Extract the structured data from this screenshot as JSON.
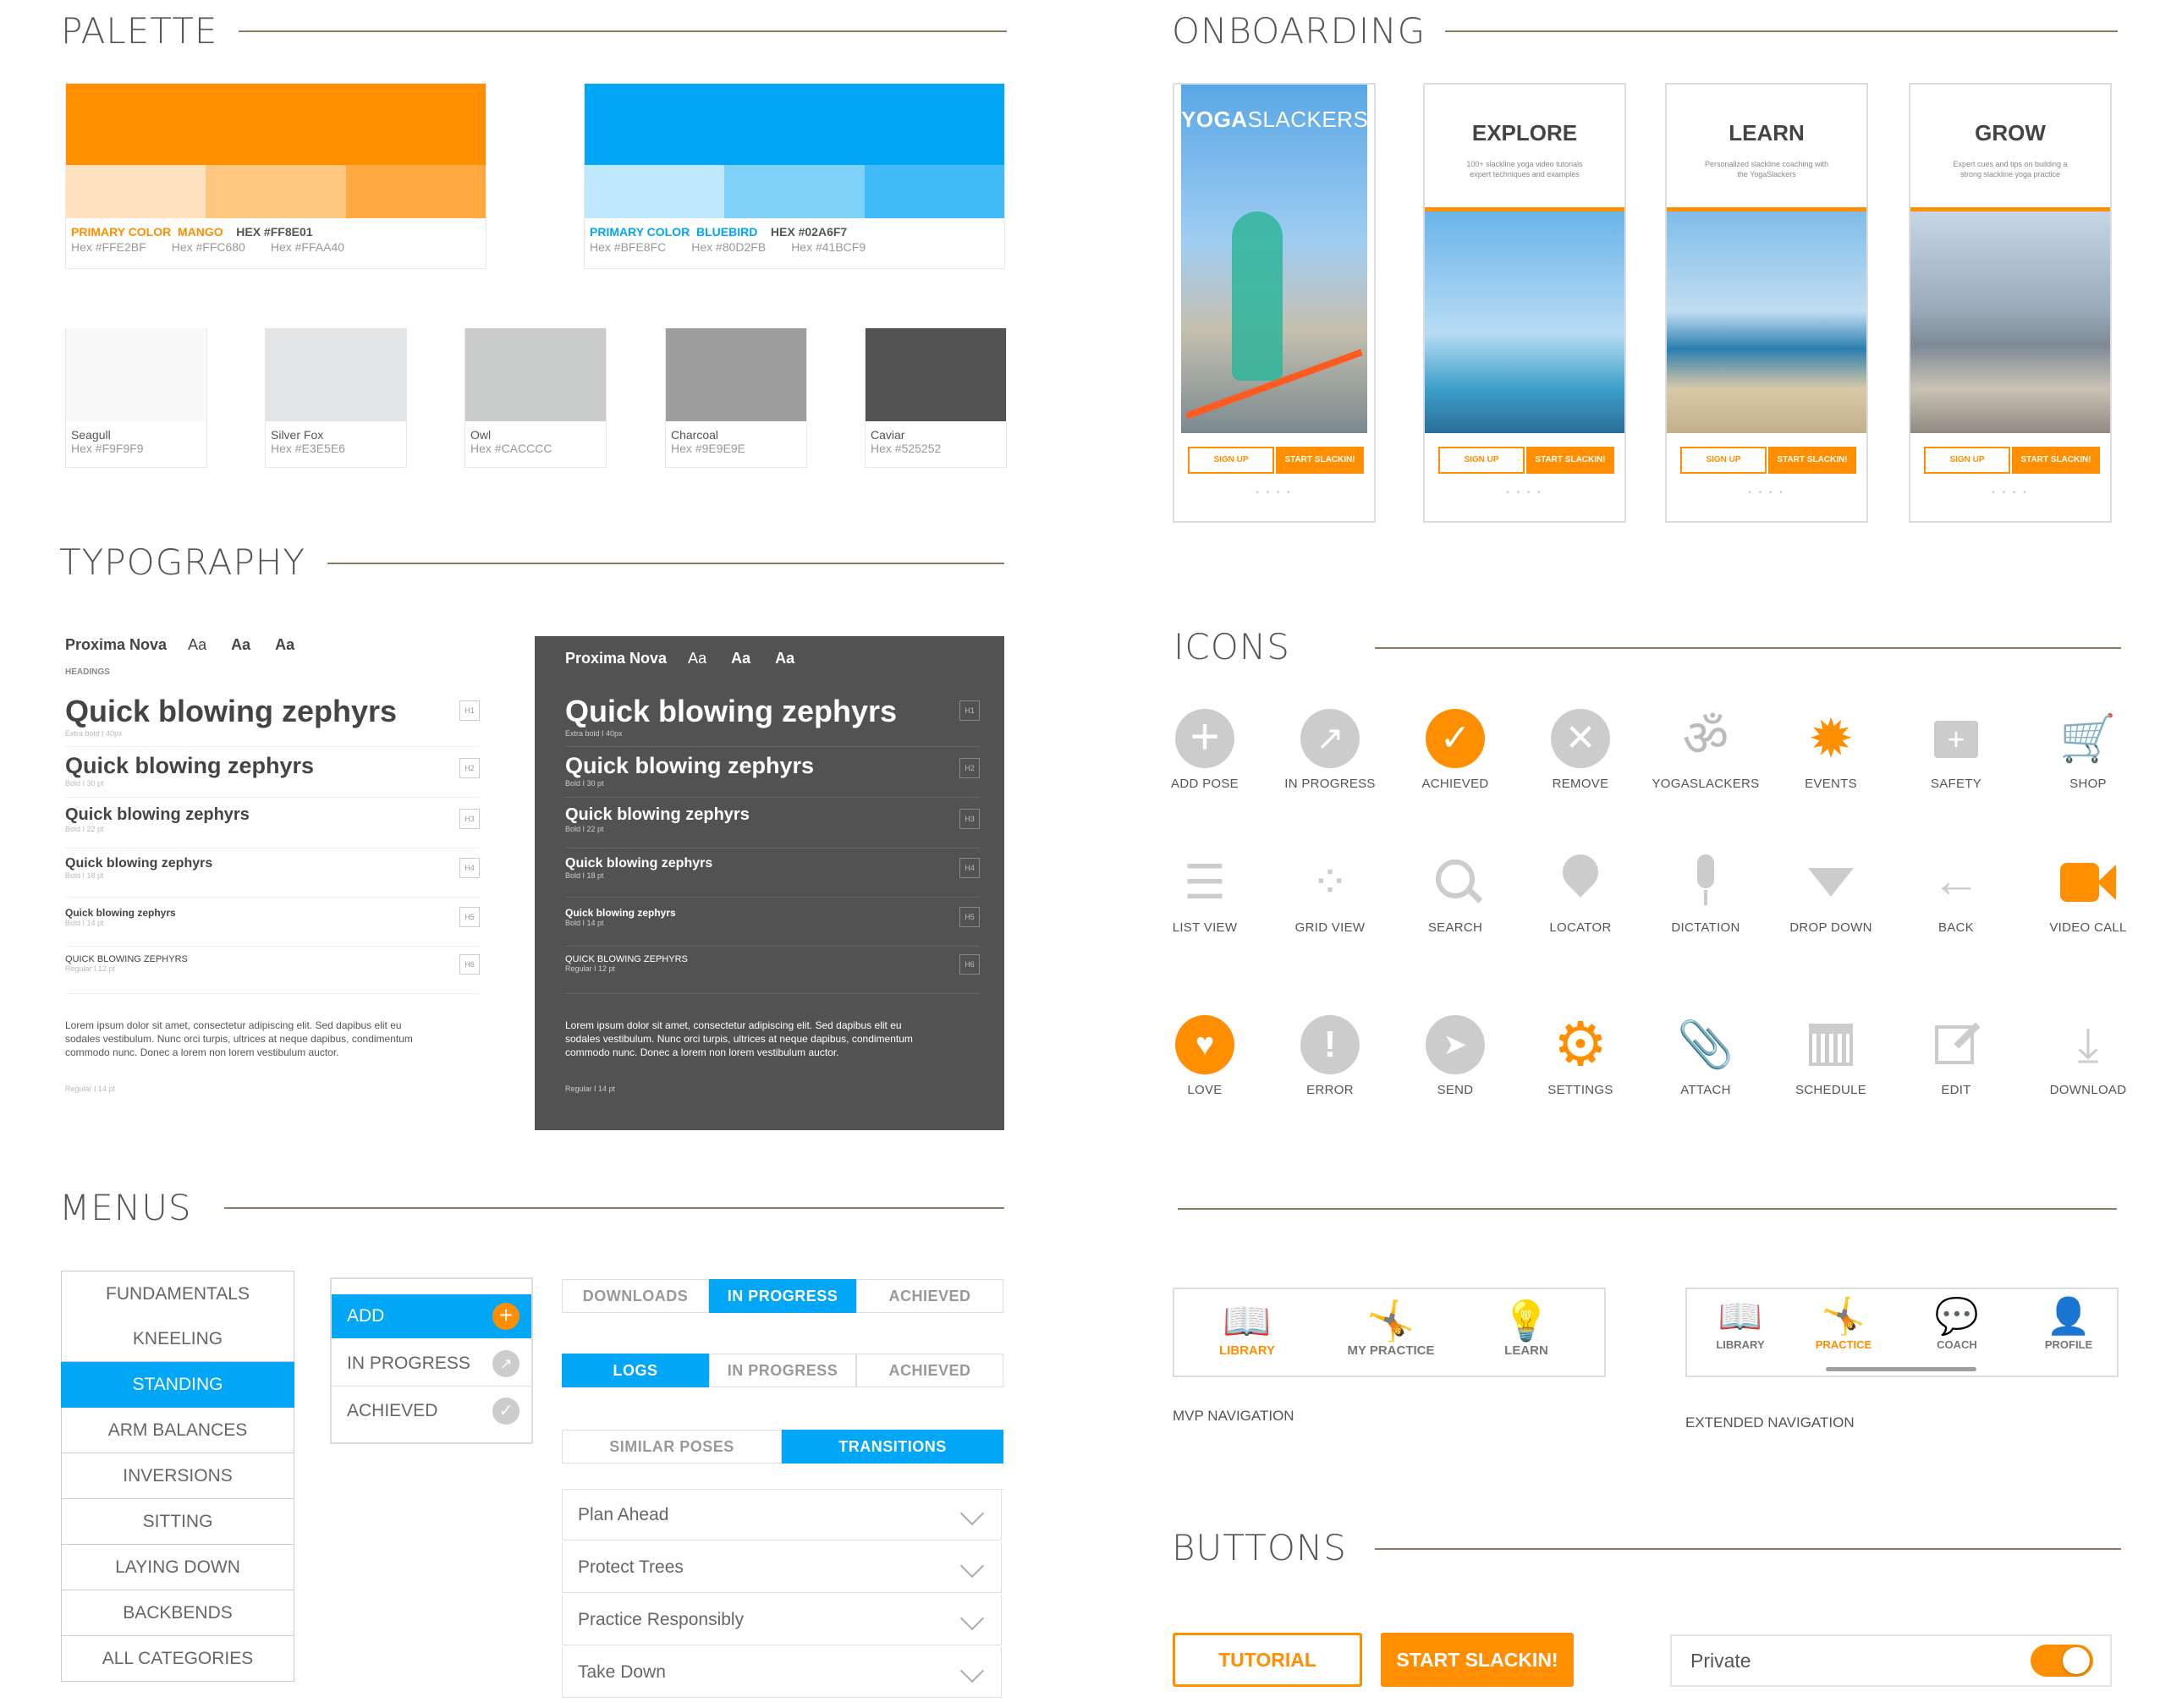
{
  "sections": {
    "palette": "PALETTE",
    "typography": "TYPOGRAPHY",
    "menus": "MENUS",
    "onboarding": "ONBOARDING",
    "icons": "ICONS",
    "buttons": "BUTTONS"
  },
  "colors": {
    "mango": "#FF8E01",
    "bluebird": "#02A6F7",
    "rule": "#8c7a5e",
    "dark_panel": "#525252"
  },
  "palette": {
    "mango": {
      "label": "PRIMARY COLOR",
      "name": "MANGO",
      "hex": "HEX #FF8E01",
      "tints": [
        "#FFE2BF",
        "#FFC680",
        "#FFAA40"
      ],
      "tint_labels": [
        "Hex #FFE2BF",
        "Hex #FFC680",
        "Hex #FFAA40"
      ]
    },
    "bluebird": {
      "label": "PRIMARY COLOR",
      "name": "BLUEBIRD",
      "hex": "HEX #02A6F7",
      "tints": [
        "#BFE8FC",
        "#80D2FB",
        "#41BCF9"
      ],
      "tint_labels": [
        "Hex #BFE8FC",
        "Hex #80D2FB",
        "Hex #41BCF9"
      ]
    },
    "grays": [
      {
        "name": "Seagull",
        "hex": "Hex #F9F9F9",
        "color": "#F9F9F9"
      },
      {
        "name": "Silver Fox",
        "hex": "Hex #E3E5E6",
        "color": "#E3E5E6"
      },
      {
        "name": "Owl",
        "hex": "Hex #CACCCC",
        "color": "#CACCCC"
      },
      {
        "name": "Charcoal",
        "hex": "Hex #9E9E9E",
        "color": "#9E9E9E"
      },
      {
        "name": "Caviar",
        "hex": "Hex #525252",
        "color": "#525252"
      }
    ]
  },
  "typography": {
    "font": "Proxima Nova",
    "aa": [
      "Aa",
      "Aa",
      "Aa"
    ],
    "headings_label": "HEADINGS",
    "rows": [
      {
        "text": "Quick blowing zephyrs",
        "meta": "Extra bold I 40px",
        "tag": "H1"
      },
      {
        "text": "Quick blowing zephyrs",
        "meta": "Bold I 30 pt",
        "tag": "H2"
      },
      {
        "text": "Quick blowing zephyrs",
        "meta": "Bold I 22 pt",
        "tag": "H3"
      },
      {
        "text": "Quick blowing zephyrs",
        "meta": "Bold I 18 pt",
        "tag": "H4"
      },
      {
        "text": "Quick blowing zephyrs",
        "meta": "Bold I 14 pt",
        "tag": "H5"
      },
      {
        "text": "QUICK BLOWING ZEPHYRS",
        "meta": "Regular I 12 pt",
        "tag": "H6"
      }
    ],
    "body": "Lorem ipsum dolor sit amet, consectetur adipiscing elit. Sed dapibus elit eu sodales vestibulum. Nunc orci turpis, ultrices at neque dapibus, condimentum commodo nunc. Donec a lorem non lorem vestibulum auctor.",
    "body_meta": "Regular I 14 pt"
  },
  "menus": {
    "categories": [
      "FUNDAMENTALS",
      "KNEELING",
      "STANDING",
      "ARM BALANCES",
      "INVERSIONS",
      "SITTING",
      "LAYING DOWN",
      "BACKBENDS",
      "ALL CATEGORIES"
    ],
    "status": [
      "ADD",
      "IN PROGRESS",
      "ACHIEVED"
    ],
    "seg1": [
      "DOWNLOADS",
      "IN PROGRESS",
      "ACHIEVED"
    ],
    "seg2": [
      "LOGS",
      "IN PROGRESS",
      "ACHIEVED"
    ],
    "seg3": [
      "SIMILAR POSES",
      "TRANSITIONS"
    ],
    "accordion": [
      "Plan Ahead",
      "Protect Trees",
      "Practice Responsibly",
      "Take Down"
    ]
  },
  "onboarding": {
    "brand_a": "YOGA",
    "brand_b": "SLACKERS",
    "cards": [
      {
        "title": "EXPLORE",
        "sub": "100+ slackline yoga video tutorials expert techniques and examples"
      },
      {
        "title": "LEARN",
        "sub": "Personalized slackline coaching with the YogaSlackers"
      },
      {
        "title": "GROW",
        "sub": "Expert cues and tips on building a strong slackline yoga practice"
      }
    ],
    "signup": "SIGN UP",
    "start": "START SLACKIN!",
    "dots": "• • • •"
  },
  "icons": [
    {
      "label": "ADD POSE",
      "icon": "add-icon"
    },
    {
      "label": "IN PROGRESS",
      "icon": "progress-icon"
    },
    {
      "label": "ACHIEVED",
      "icon": "check-icon"
    },
    {
      "label": "REMOVE",
      "icon": "remove-icon"
    },
    {
      "label": "YOGASLACKERS",
      "icon": "om-icon"
    },
    {
      "label": "EVENTS",
      "icon": "sun-icon"
    },
    {
      "label": "SAFETY",
      "icon": "first-aid-icon"
    },
    {
      "label": "SHOP",
      "icon": "cart-icon"
    },
    {
      "label": "LIST VIEW",
      "icon": "list-icon"
    },
    {
      "label": "GRID VIEW",
      "icon": "grid-icon"
    },
    {
      "label": "SEARCH",
      "icon": "search-icon"
    },
    {
      "label": "LOCATOR",
      "icon": "pin-icon"
    },
    {
      "label": "DICTATION",
      "icon": "mic-icon"
    },
    {
      "label": "DROP DOWN",
      "icon": "triangle-down-icon"
    },
    {
      "label": "BACK",
      "icon": "arrow-left-icon"
    },
    {
      "label": "VIDEO CALL",
      "icon": "video-icon"
    },
    {
      "label": "LOVE",
      "icon": "heart-icon"
    },
    {
      "label": "ERROR",
      "icon": "error-icon"
    },
    {
      "label": "SEND",
      "icon": "send-icon"
    },
    {
      "label": "SETTINGS",
      "icon": "gear-icon"
    },
    {
      "label": "ATTACH",
      "icon": "paperclip-icon"
    },
    {
      "label": "SCHEDULE",
      "icon": "calendar-icon"
    },
    {
      "label": "EDIT",
      "icon": "edit-icon"
    },
    {
      "label": "DOWNLOAD",
      "icon": "download-icon"
    }
  ],
  "nav": {
    "mvp": [
      "LIBRARY",
      "MY PRACTICE",
      "LEARN"
    ],
    "mvp_caption": "MVP NAVIGATION",
    "extended": [
      "LIBRARY",
      "PRACTICE",
      "COACH",
      "PROFILE"
    ],
    "extended_caption": "EXTENDED NAVIGATION"
  },
  "buttons": {
    "tutorial": "TUTORIAL",
    "start": "START SLACKIN!",
    "private": "Private"
  }
}
